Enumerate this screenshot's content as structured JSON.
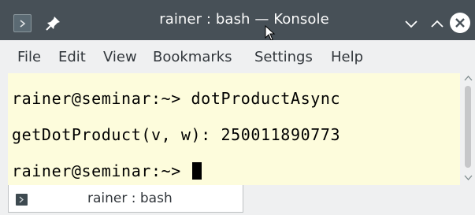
{
  "window": {
    "title": "rainer : bash — Konsole",
    "icons": {
      "app": "terminal-app-icon",
      "pin": "pin-icon",
      "minimize": "chevron-down-icon",
      "maximize": "chevron-up-icon",
      "close": "close-icon"
    }
  },
  "menu": {
    "items": [
      "File",
      "Edit",
      "View",
      "Bookmarks",
      "Settings",
      "Help"
    ]
  },
  "terminal": {
    "lines": [
      "rainer@seminar:~> dotProductAsync",
      "getDotProduct(v, w): 250011890773",
      "rainer@seminar:~> "
    ]
  },
  "tabs": [
    {
      "label": "rainer : bash",
      "icon": "terminal-tab-icon"
    }
  ],
  "colors": {
    "titlebar": "#475057",
    "terminal_background": "#fdfcdc",
    "menubar": "#eff0f1"
  }
}
